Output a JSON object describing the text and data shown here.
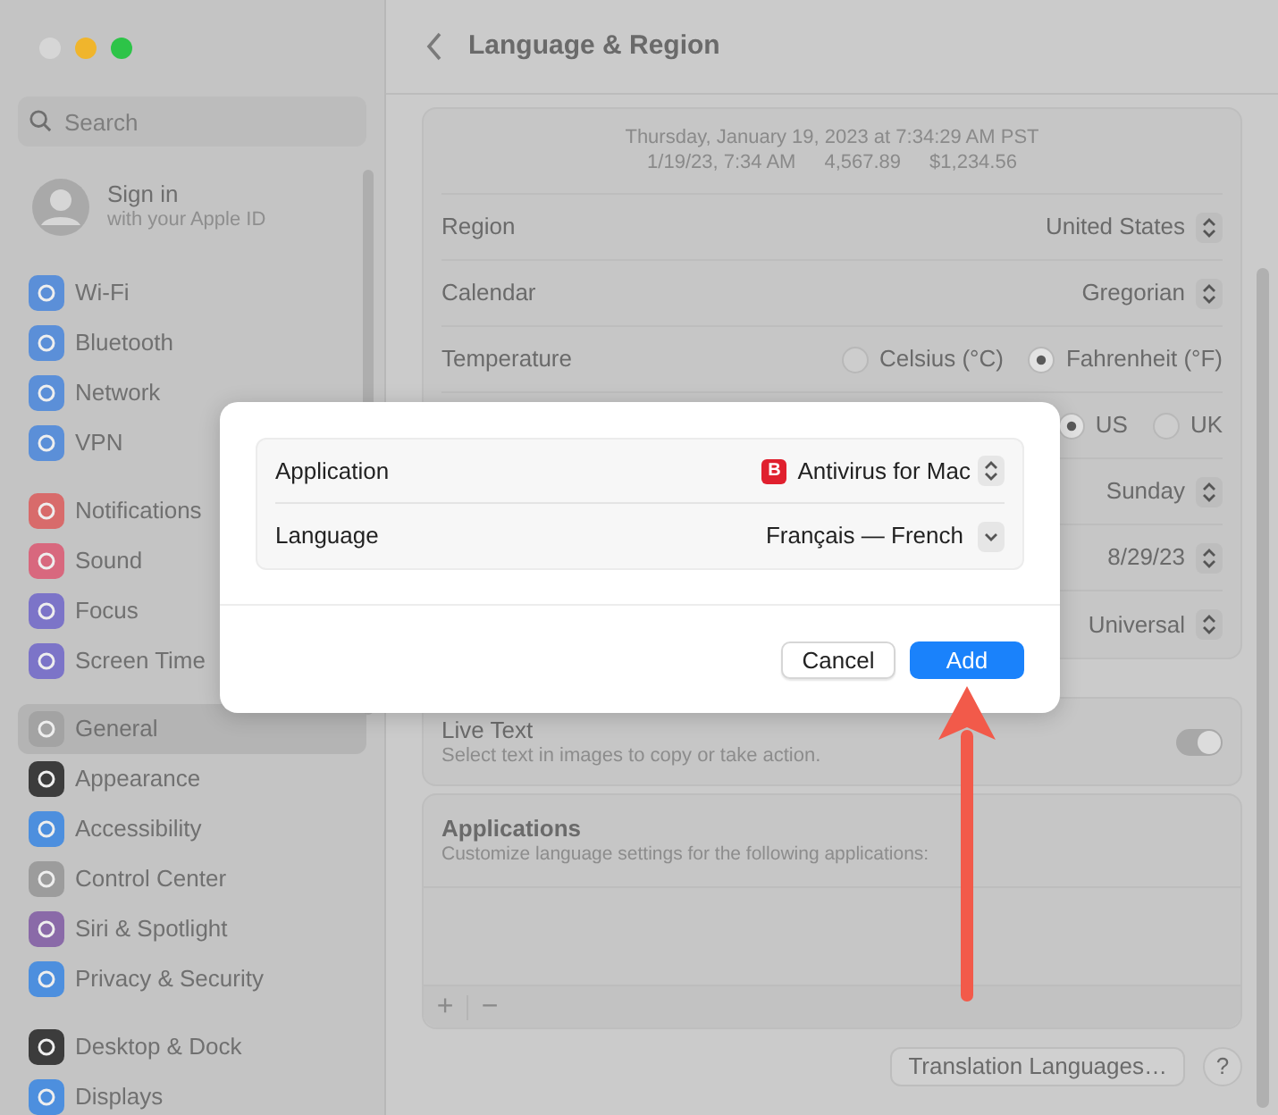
{
  "sidebar": {
    "search": {
      "placeholder": "Search"
    },
    "account": {
      "title": "Sign in",
      "subtitle": "with your Apple ID"
    },
    "groups": [
      [
        {
          "label": "Wi-Fi",
          "selected": false,
          "color": "#5b8fd8"
        },
        {
          "label": "Bluetooth",
          "selected": false,
          "color": "#5b8fd8"
        },
        {
          "label": "Network",
          "selected": false,
          "color": "#5b8fd8"
        },
        {
          "label": "VPN",
          "selected": false,
          "color": "#5b8fd8"
        }
      ],
      [
        {
          "label": "Notifications",
          "selected": false,
          "color": "#d86b6b"
        },
        {
          "label": "Sound",
          "selected": false,
          "color": "#d8687e"
        },
        {
          "label": "Focus",
          "selected": false,
          "color": "#7c74c8"
        },
        {
          "label": "Screen Time",
          "selected": false,
          "color": "#7c74c8"
        }
      ],
      [
        {
          "label": "General",
          "selected": true,
          "color": "#a3a3a3"
        },
        {
          "label": "Appearance",
          "selected": false,
          "color": "#3c3c3c"
        },
        {
          "label": "Accessibility",
          "selected": false,
          "color": "#4d8fde"
        },
        {
          "label": "Control Center",
          "selected": false,
          "color": "#9c9c9c"
        },
        {
          "label": "Siri & Spotlight",
          "selected": false,
          "color": "#8a6aa8"
        },
        {
          "label": "Privacy & Security",
          "selected": false,
          "color": "#4d8fde"
        }
      ],
      [
        {
          "label": "Desktop & Dock",
          "selected": false,
          "color": "#3c3c3c"
        },
        {
          "label": "Displays",
          "selected": false,
          "color": "#4d8fde"
        }
      ]
    ]
  },
  "header": {
    "title": "Language & Region"
  },
  "preview": {
    "line_1": "Thursday, January 19, 2023 at 7:34:29 AM PST",
    "line_2": [
      "1/19/23, 7:34 AM",
      "4,567.89",
      "$1,234.56"
    ]
  },
  "settings": [
    {
      "kind": "popup",
      "label": "Region",
      "value": "United States"
    },
    {
      "kind": "popup",
      "label": "Calendar",
      "value": "Gregorian"
    },
    {
      "kind": "radio",
      "label": "Temperature",
      "options": [
        {
          "label": "Celsius (°C)",
          "selected": false
        },
        {
          "label": "Fahrenheit (°F)",
          "selected": true
        }
      ]
    },
    {
      "kind": "radio",
      "options": [
        {
          "label": "US",
          "selected": true
        },
        {
          "label": "UK",
          "selected": false
        }
      ]
    },
    {
      "kind": "popup",
      "value": "Sunday"
    },
    {
      "kind": "popup",
      "value": "8/29/23"
    },
    {
      "kind": "popup",
      "value": "Universal"
    }
  ],
  "live_text": {
    "title": "Live Text",
    "description": "Select text in images to copy or take action.",
    "on": true
  },
  "applications": {
    "title": "Applications",
    "description": "Customize language settings for the following applications:",
    "add": "+",
    "remove": "−"
  },
  "footer": {
    "button": "Translation Languages…",
    "help": "?"
  },
  "dialog": {
    "fields": [
      {
        "kind": "popup",
        "label": "Application",
        "value": "Antivirus for Mac",
        "badge": "B"
      },
      {
        "kind": "pulldown",
        "label": "Language",
        "value": "Français — French"
      }
    ],
    "buttons": [
      {
        "label": "Cancel",
        "default": false
      },
      {
        "label": "Add",
        "default": true
      }
    ]
  }
}
